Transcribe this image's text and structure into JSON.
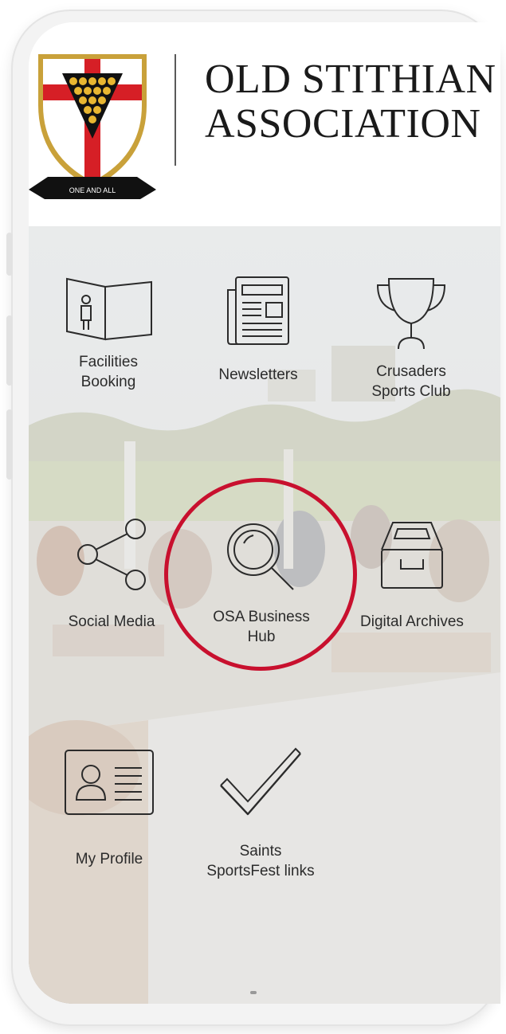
{
  "header": {
    "org_line1": "OLD STITHIAN",
    "org_line2": "ASSOCIATION",
    "crest_motto": "ONE AND ALL"
  },
  "menu": {
    "facilities_booking": "Facilities\nBooking",
    "newsletters": "Newsletters",
    "crusaders_sports_club": "Crusaders\nSports Club",
    "social_media": "Social Media",
    "osa_business_hub": "OSA Business\nHub",
    "digital_archives": "Digital Archives",
    "my_profile": "My Profile",
    "saints_sportsfest_links": "Saints\nSportsFest links"
  },
  "colors": {
    "highlight_ring": "#c8102e",
    "icon_stroke": "#2b2b2b",
    "crest_red": "#d61f26",
    "crest_gold": "#e8b631"
  }
}
